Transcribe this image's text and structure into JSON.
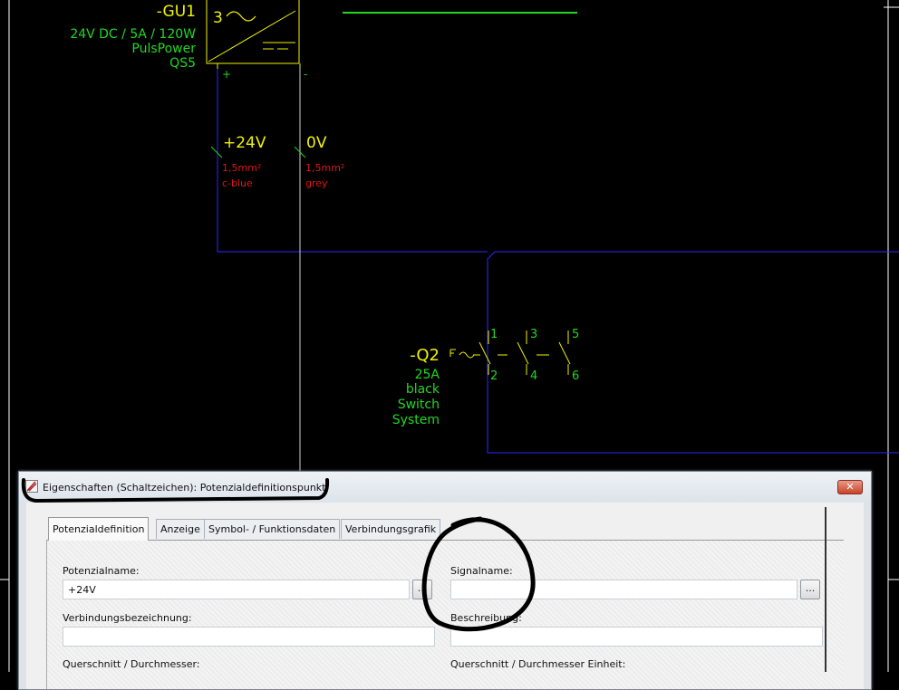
{
  "schematic": {
    "psu": {
      "tag": "-GU1",
      "number": "3",
      "rating": "24V DC / 5A / 120W",
      "maker": "PulsPower",
      "model": "QS5",
      "plus_pin": "+",
      "minus_pin": "-"
    },
    "potentials": [
      {
        "name": "+24V",
        "cross_section": "1,5mm²",
        "color": "c-blue"
      },
      {
        "name": "0V",
        "cross_section": "1,5mm²",
        "color": "grey"
      }
    ],
    "switch": {
      "tag": "-Q2",
      "rating": "25A",
      "color_line": "black",
      "desc1": "Switch",
      "desc2": "System",
      "pins_top": [
        "1",
        "3",
        "5"
      ],
      "pins_bottom": [
        "2",
        "4",
        "6"
      ]
    }
  },
  "dialog": {
    "title": "Eigenschaften (Schaltzeichen): Potenzialdefinitionspunkt",
    "close_label": "✕",
    "tabs": [
      {
        "label": "Potenzialdefinition",
        "active": true
      },
      {
        "label": "Anzeige",
        "active": false
      },
      {
        "label": "Symbol- / Funktionsdaten",
        "active": false
      },
      {
        "label": "Verbindungsgrafik",
        "active": false
      }
    ],
    "fields": {
      "potential_name": {
        "label": "Potenzialname:",
        "value": "+24V"
      },
      "signal_name": {
        "label": "Signalname:",
        "value": ""
      },
      "connection_designation": {
        "label": "Verbindungsbezeichnung:",
        "value": ""
      },
      "description": {
        "label": "Beschreibung:",
        "value": ""
      },
      "cross_section": {
        "label": "Querschnitt / Durchmesser:"
      },
      "cross_section_unit": {
        "label": "Querschnitt / Durchmesser Einheit:"
      }
    },
    "browse_label": "..."
  },
  "colors": {
    "background": "#000000",
    "wire": "#2a2aff",
    "component": "#f2f200",
    "text_green": "#22d822",
    "text_red": "#e01515"
  }
}
